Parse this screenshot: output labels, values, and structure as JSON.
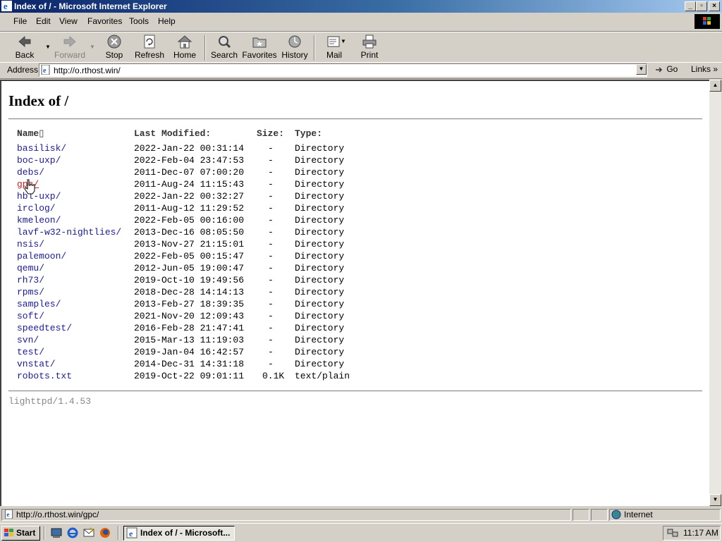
{
  "window": {
    "title": "Index of / - Microsoft Internet Explorer"
  },
  "menu": [
    {
      "label": "File",
      "key": "F"
    },
    {
      "label": "Edit",
      "key": "E"
    },
    {
      "label": "View",
      "key": "V"
    },
    {
      "label": "Favorites",
      "key": "a"
    },
    {
      "label": "Tools",
      "key": "T"
    },
    {
      "label": "Help",
      "key": "H"
    }
  ],
  "toolbar": {
    "back": "Back",
    "forward": "Forward",
    "stop": "Stop",
    "refresh": "Refresh",
    "home": "Home",
    "search": "Search",
    "favorites": "Favorites",
    "history": "History",
    "mail": "Mail",
    "print": "Print"
  },
  "address": {
    "label": "Address",
    "url": "http://o.rthost.win/",
    "go": "Go",
    "links": "Links"
  },
  "page": {
    "title": "Index of /",
    "headers": {
      "name": "Name",
      "modified": "Last Modified:",
      "size": "Size:",
      "type": "Type:"
    },
    "entries": [
      {
        "name": "basilisk/",
        "modified": "2022-Jan-22 00:31:14",
        "size": "-",
        "type": "Directory"
      },
      {
        "name": "boc-uxp/",
        "modified": "2022-Feb-04 23:47:53",
        "size": "-",
        "type": "Directory"
      },
      {
        "name": "debs/",
        "modified": "2011-Dec-07 07:00:20",
        "size": "-",
        "type": "Directory"
      },
      {
        "name": "gpc/",
        "modified": "2011-Aug-24 11:15:43",
        "size": "-",
        "type": "Directory"
      },
      {
        "name": "hbl-uxp/",
        "modified": "2022-Jan-22 00:32:27",
        "size": "-",
        "type": "Directory"
      },
      {
        "name": "irclog/",
        "modified": "2011-Aug-12 11:29:52",
        "size": "-",
        "type": "Directory"
      },
      {
        "name": "kmeleon/",
        "modified": "2022-Feb-05 00:16:00",
        "size": "-",
        "type": "Directory"
      },
      {
        "name": "lavf-w32-nightlies/",
        "modified": "2013-Dec-16 08:05:50",
        "size": "-",
        "type": "Directory"
      },
      {
        "name": "nsis/",
        "modified": "2013-Nov-27 21:15:01",
        "size": "-",
        "type": "Directory"
      },
      {
        "name": "palemoon/",
        "modified": "2022-Feb-05 00:15:47",
        "size": "-",
        "type": "Directory"
      },
      {
        "name": "qemu/",
        "modified": "2012-Jun-05 19:00:47",
        "size": "-",
        "type": "Directory"
      },
      {
        "name": "rh73/",
        "modified": "2019-Oct-10 19:49:56",
        "size": "-",
        "type": "Directory"
      },
      {
        "name": "rpms/",
        "modified": "2018-Dec-28 14:14:13",
        "size": "-",
        "type": "Directory"
      },
      {
        "name": "samples/",
        "modified": "2013-Feb-27 18:39:35",
        "size": "-",
        "type": "Directory"
      },
      {
        "name": "soft/",
        "modified": "2021-Nov-20 12:09:43",
        "size": "-",
        "type": "Directory"
      },
      {
        "name": "speedtest/",
        "modified": "2016-Feb-28 21:47:41",
        "size": "-",
        "type": "Directory"
      },
      {
        "name": "svn/",
        "modified": "2015-Mar-13 11:19:03",
        "size": "-",
        "type": "Directory"
      },
      {
        "name": "test/",
        "modified": "2019-Jan-04 16:42:57",
        "size": "-",
        "type": "Directory"
      },
      {
        "name": "vnstat/",
        "modified": "2014-Dec-31 14:31:18",
        "size": "-",
        "type": "Directory"
      },
      {
        "name": "robots.txt",
        "modified": "2019-Oct-22 09:01:11",
        "size": "0.1K",
        "type": "text/plain"
      }
    ],
    "footer": "lighttpd/1.4.53"
  },
  "status": {
    "text": "http://o.rthost.win/gpc/",
    "zone": "Internet"
  },
  "taskbar": {
    "start": "Start",
    "task": "Index of / - Microsoft...",
    "clock": "11:17 AM"
  }
}
